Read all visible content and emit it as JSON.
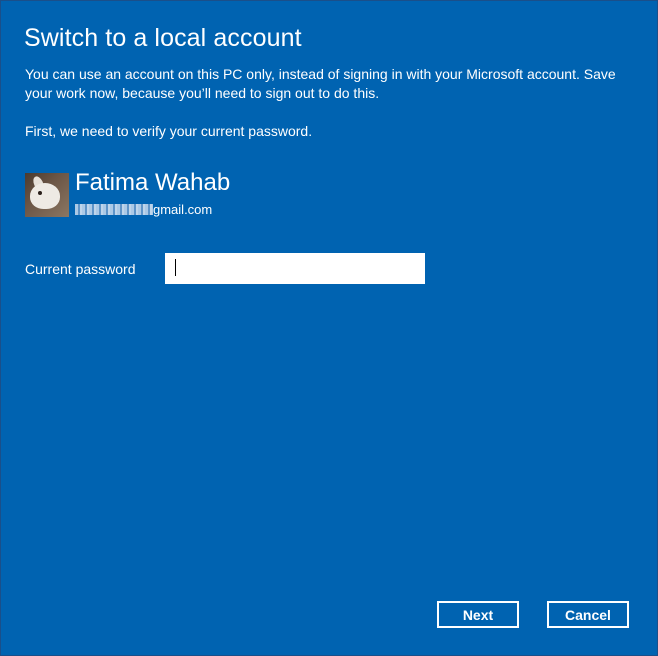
{
  "dialog": {
    "title": "Switch to a local account",
    "description": "You can use an account on this PC only, instead of signing in with your Microsoft account. Save your work now, because you’ll need to sign out to do this.",
    "verify_text": "First, we need to verify your current password."
  },
  "user": {
    "name": "Fatima Wahab",
    "email_visible_suffix": "gmail.com",
    "avatar": "user-avatar-photo"
  },
  "form": {
    "password_label": "Current password",
    "password_value": ""
  },
  "buttons": {
    "next_label": "Next",
    "cancel_label": "Cancel"
  },
  "colors": {
    "background": "#0063b1",
    "text": "#ffffff"
  }
}
